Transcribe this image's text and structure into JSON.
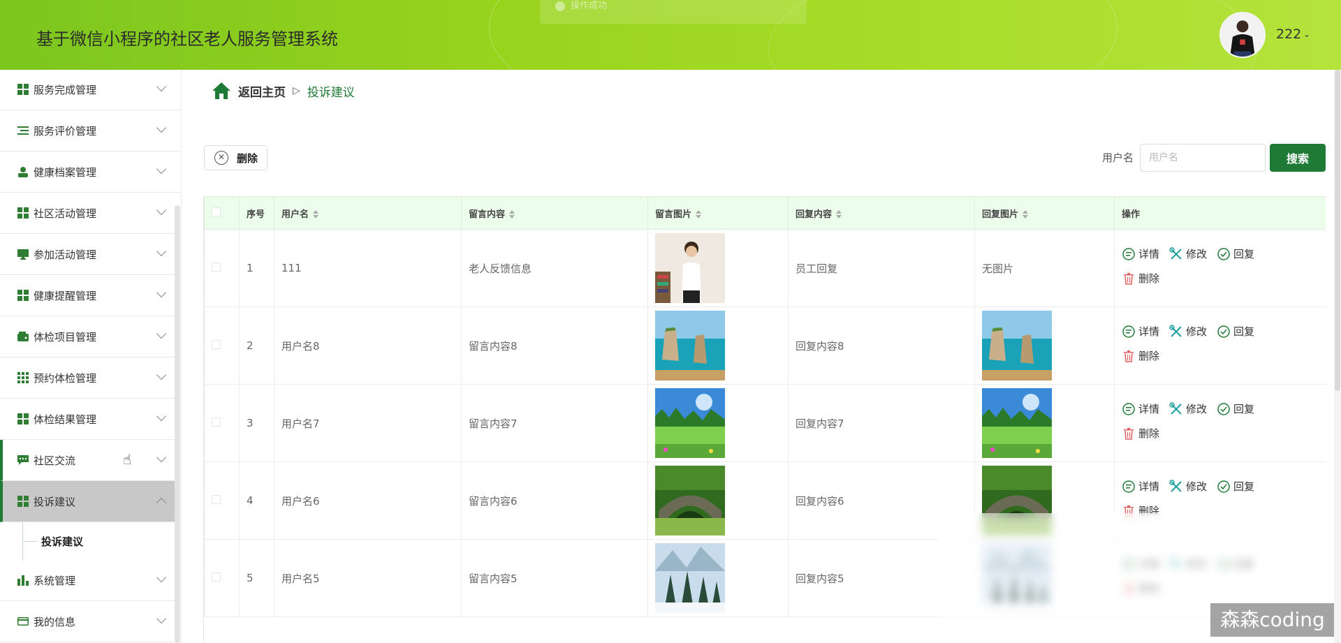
{
  "app": {
    "title": "基于微信小程序的社区老人服务管理系统",
    "toast": "操作成功",
    "user": "222"
  },
  "sidebar": {
    "items": [
      {
        "label": "服务完成管理",
        "icon": "grid-icon"
      },
      {
        "label": "服务评价管理",
        "icon": "list-icon"
      },
      {
        "label": "健康档案管理",
        "icon": "person-icon"
      },
      {
        "label": "社区活动管理",
        "icon": "grid-icon"
      },
      {
        "label": "参加活动管理",
        "icon": "monitor-icon"
      },
      {
        "label": "健康提醒管理",
        "icon": "grid-icon"
      },
      {
        "label": "体检项目管理",
        "icon": "wallet-icon"
      },
      {
        "label": "预约体检管理",
        "icon": "apps-icon"
      },
      {
        "label": "体检结果管理",
        "icon": "grid-icon"
      },
      {
        "label": "社区交流",
        "icon": "chat-icon"
      },
      {
        "label": "投诉建议",
        "icon": "grid-icon"
      },
      {
        "label": "系统管理",
        "icon": "bar-chart-icon"
      },
      {
        "label": "我的信息",
        "icon": "card-icon"
      }
    ],
    "sub_item": "投诉建议"
  },
  "breadcrumb": {
    "home": "返回主页",
    "current": "投诉建议"
  },
  "toolbar": {
    "delete_label": "删除",
    "search_label": "用户名",
    "search_placeholder": "用户名",
    "search_button": "搜索"
  },
  "table": {
    "headers": [
      "序号",
      "用户名",
      "留言内容",
      "留言图片",
      "回复内容",
      "回复图片",
      "操作"
    ],
    "actions": [
      "详情",
      "修改",
      "回复",
      "删除"
    ],
    "rows": [
      {
        "index": "1",
        "username": "111",
        "content": "老人反馈信息",
        "msg_image": "person-photo",
        "reply": "员工回复",
        "reply_image_text": "无图片",
        "reply_image": ""
      },
      {
        "index": "2",
        "username": "用户名8",
        "content": "留言内容8",
        "msg_image": "sea-rocks",
        "reply": "回复内容8",
        "reply_image_text": "",
        "reply_image": "sea-rocks"
      },
      {
        "index": "3",
        "username": "用户名7",
        "content": "留言内容7",
        "msg_image": "meadow",
        "reply": "回复内容7",
        "reply_image_text": "",
        "reply_image": "meadow"
      },
      {
        "index": "4",
        "username": "用户名6",
        "content": "留言内容6",
        "msg_image": "stone-bridge",
        "reply": "回复内容6",
        "reply_image_text": "",
        "reply_image": "stone-bridge"
      },
      {
        "index": "5",
        "username": "用户名5",
        "content": "留言内容5",
        "msg_image": "snow-forest",
        "reply": "回复内容5",
        "reply_image_text": "",
        "reply_image": "snow-forest"
      }
    ]
  },
  "watermark": "森森coding",
  "colors": {
    "accent": "#1f7a36",
    "header_start": "#7cc61f",
    "header_end": "#b5e33c",
    "table_header_bg": "#ecfdec"
  }
}
